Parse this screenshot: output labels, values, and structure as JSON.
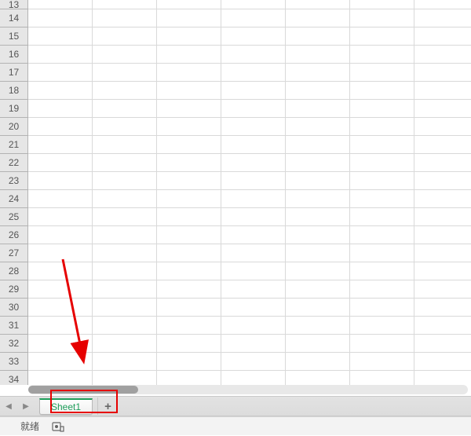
{
  "rows": [
    "13",
    "14",
    "15",
    "16",
    "17",
    "18",
    "19",
    "20",
    "21",
    "22",
    "23",
    "24",
    "25",
    "26",
    "27",
    "28",
    "29",
    "30",
    "31",
    "32",
    "33",
    "34"
  ],
  "tabs": {
    "sheet1_label": "Sheet1",
    "add_label": "+"
  },
  "nav": {
    "prev": "◀",
    "next": "▶"
  },
  "status": {
    "ready": "就绪"
  }
}
